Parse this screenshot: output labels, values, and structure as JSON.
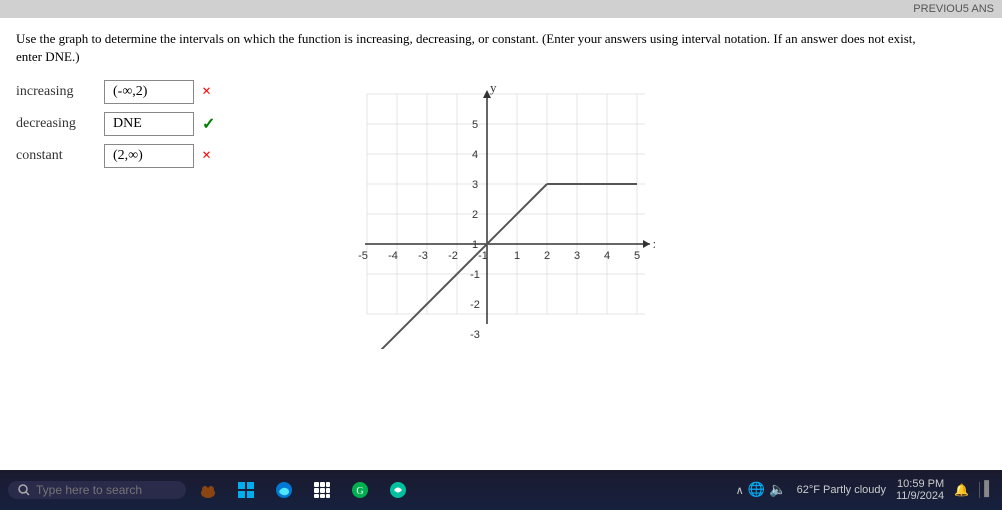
{
  "instruction": {
    "text": "Use the graph to determine the intervals on which the function is increasing, decreasing, or constant. (Enter your answers using interval notation. If an answer does not exist, enter DNE.)"
  },
  "answers": [
    {
      "id": "increasing",
      "label": "increasing",
      "value": "(-∞,2)",
      "status": "wrong",
      "status_symbol": "×"
    },
    {
      "id": "decreasing",
      "label": "decreasing",
      "value": "DNE",
      "status": "correct",
      "status_symbol": "✓"
    },
    {
      "id": "constant",
      "label": "constant",
      "value": "(2,∞)",
      "status": "wrong",
      "status_symbol": "×"
    }
  ],
  "graph": {
    "x_label": "x",
    "y_label": "y",
    "x_min": -5,
    "x_max": 5,
    "y_min": -3,
    "y_max": 5
  },
  "taskbar": {
    "search_placeholder": "Type here to search",
    "weather": "62°F  Partly cloudy",
    "time": "10:59 PM",
    "date": "11/9/2024"
  }
}
